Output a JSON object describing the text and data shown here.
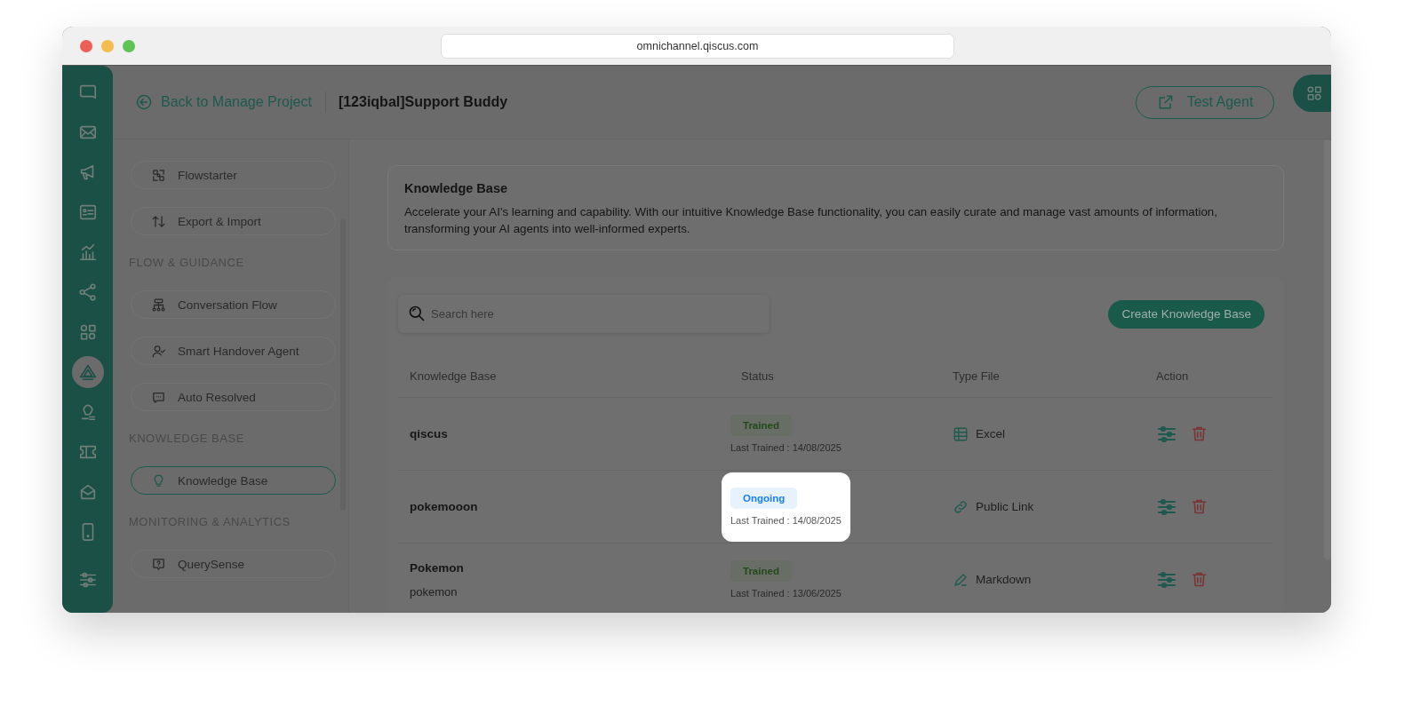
{
  "browser": {
    "url": "omnichannel.qiscus.com"
  },
  "rail": {
    "items": [
      {
        "selected": false
      },
      {
        "selected": false
      },
      {
        "selected": false
      },
      {
        "selected": false
      },
      {
        "selected": false
      },
      {
        "selected": false
      },
      {
        "selected": false
      },
      {
        "selected": true
      },
      {
        "selected": false
      },
      {
        "selected": false
      },
      {
        "selected": false
      },
      {
        "selected": false
      }
    ],
    "bottom": [
      {
        "selected": false
      }
    ]
  },
  "header": {
    "back_link": "Back to Manage Project",
    "project_title": "[123iqbal]Support Buddy",
    "test_button": "Test Agent"
  },
  "menu": [
    {
      "kind": "item",
      "label": "Flowstarter",
      "selected": false
    },
    {
      "kind": "item",
      "label": "Export & Import",
      "selected": false
    },
    {
      "kind": "section",
      "label": "FLOW & GUIDANCE"
    },
    {
      "kind": "item",
      "label": "Conversation Flow",
      "selected": false
    },
    {
      "kind": "item",
      "label": "Smart Handover Agent",
      "selected": false
    },
    {
      "kind": "item",
      "label": "Auto Resolved",
      "selected": false
    },
    {
      "kind": "section",
      "label": "KNOWLEDGE BASE"
    },
    {
      "kind": "item",
      "label": "Knowledge Base",
      "selected": true
    },
    {
      "kind": "section",
      "label": "MONITORING & ANALYTICS"
    },
    {
      "kind": "item",
      "label": "QuerySense",
      "selected": false
    }
  ],
  "intro": {
    "title": "Knowledge Base",
    "description": "Accelerate your AI's learning and capability. With our intuitive Knowledge Base functionality, you can easily curate and manage vast amounts of information, transforming your AI agents into well-informed experts."
  },
  "toolbar": {
    "search": {
      "placeholder": "Search here"
    },
    "create_button": "Create Knowledge Base"
  },
  "table": {
    "columns": [
      "Knowledge Base",
      "Status",
      "Type File",
      "Action"
    ],
    "rows": [
      {
        "name": "qiscus",
        "status": {
          "label": "Trained",
          "kind": "trained"
        },
        "last_trained": "Last Trained : 14/08/2025",
        "type": {
          "label": "Excel",
          "kind": "sheet"
        },
        "highlighted": false
      },
      {
        "name": "pokemooon",
        "status": {
          "label": "Ongoing",
          "kind": "ongoing"
        },
        "last_trained": "Last Trained : 14/08/2025",
        "type": {
          "label": "Public Link",
          "kind": "link"
        },
        "highlighted": true
      },
      {
        "name": "Pokemon",
        "description": "pokemon",
        "status": {
          "label": "Trained",
          "kind": "trained"
        },
        "last_trained": "Last Trained : 13/06/2025",
        "type": {
          "label": "Markdown",
          "kind": "pen"
        },
        "highlighted": false
      }
    ]
  }
}
